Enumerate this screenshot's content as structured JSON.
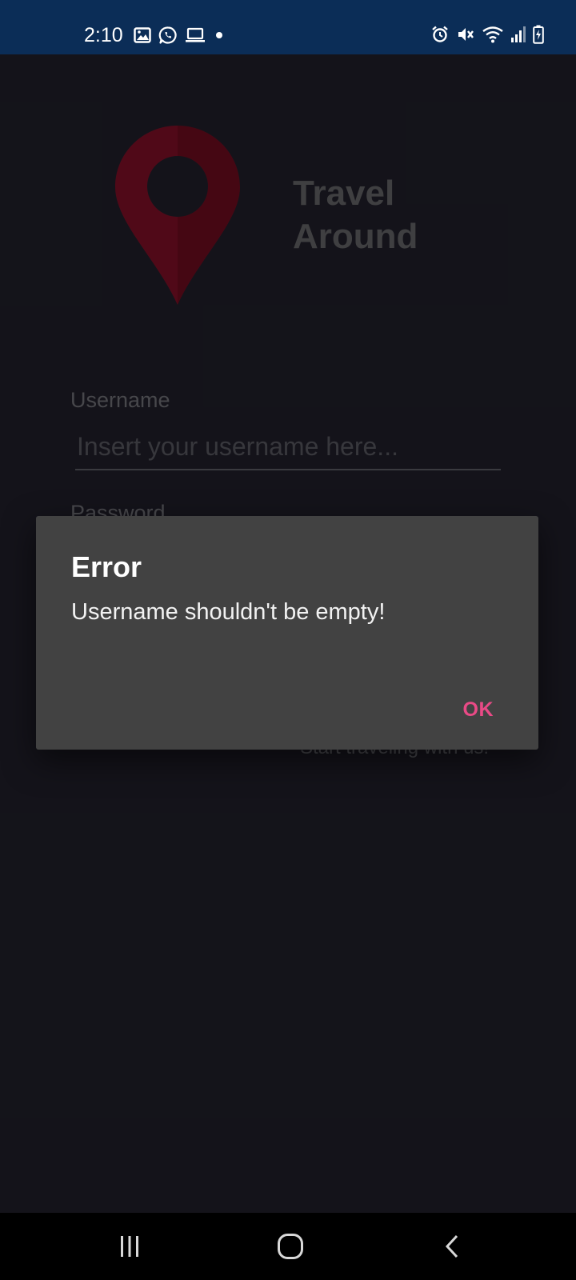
{
  "status_bar": {
    "time": "2:10",
    "left_icons": [
      "gallery-icon",
      "whatsapp-icon",
      "laptop-icon",
      "notification-dot-icon"
    ],
    "right_icons": [
      "alarm-icon",
      "mute-icon",
      "wifi-icon",
      "signal-icon",
      "battery-charging-icon"
    ],
    "background": "#0b2d57"
  },
  "app": {
    "title_line1": "Travel",
    "title_line2": "Around",
    "logo_icon": "location-pin-icon",
    "logo_color": "#7a0a1e",
    "username_label": "Username",
    "username_placeholder": "Insert your username here...",
    "username_value": "",
    "password_label": "Password",
    "register_text": "Start traveling with us!",
    "background": "#1c1b23"
  },
  "dialog": {
    "title": "Error",
    "message": "Username shouldn't be empty!",
    "ok_label": "OK",
    "accent": "#e94a86"
  },
  "nav_bar": {
    "buttons": [
      "recents-icon",
      "home-icon",
      "back-icon"
    ]
  }
}
